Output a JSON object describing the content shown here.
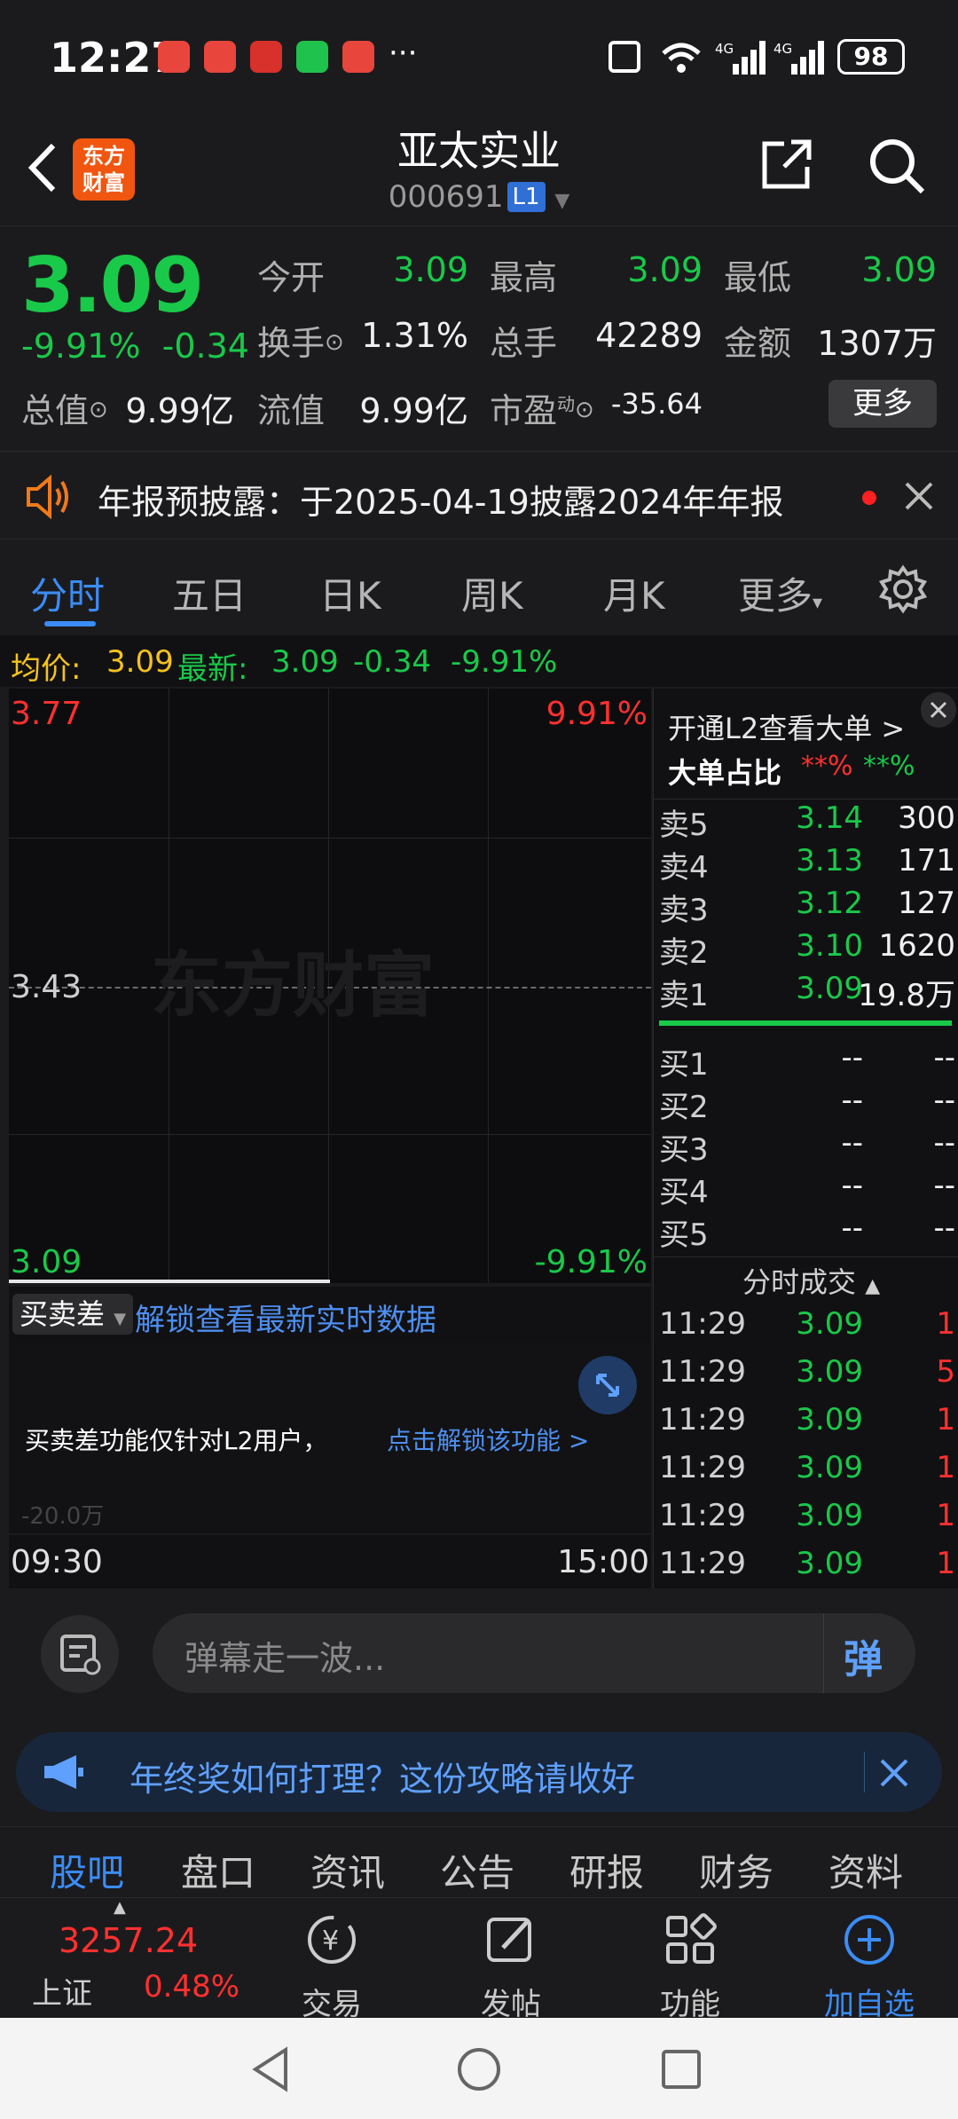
{
  "status_bar": {
    "time": "12:27",
    "battery": "98",
    "network": "4G"
  },
  "header": {
    "logo_line1": "东方",
    "logo_line2": "财富",
    "title": "亚太实业",
    "code": "000691",
    "level": "L1"
  },
  "quote": {
    "price": "3.09",
    "change_pct": "-9.91%",
    "change": "-0.34",
    "open_label": "今开",
    "open": "3.09",
    "high_label": "最高",
    "high": "3.09",
    "low_label": "最低",
    "low": "3.09",
    "turnover_label": "换手",
    "turnover": "1.31%",
    "volume_label": "总手",
    "volume": "42289",
    "amount_label": "金额",
    "amount": "1307万",
    "mcap_label": "总值",
    "mcap": "9.99亿",
    "float_label": "流值",
    "float": "9.99亿",
    "pe_label": "市盈",
    "pe_sup": "动",
    "pe": "-35.64",
    "more_label": "更多"
  },
  "notice": {
    "text": "年报预披露：于2025-04-19披露2024年年报"
  },
  "tabs": [
    "分时",
    "五日",
    "日K",
    "周K",
    "月K",
    "更多"
  ],
  "avg_line": {
    "avg_label": "均价:",
    "avg": "3.09",
    "latest_label": "最新:",
    "latest": "3.09",
    "change": "-0.34",
    "pct": "-9.91%"
  },
  "chart": {
    "top_price": "3.77",
    "top_pct": "9.91%",
    "mid_price": "3.43",
    "bottom_price": "3.09",
    "bottom_pct": "-9.91%",
    "watermark": "东方财富",
    "start_time": "09:30",
    "end_time": "15:00"
  },
  "sub_chart": {
    "selector": "买卖差",
    "unlock_link": "解锁查看最新实时数据",
    "info_text": "买卖差功能仅针对L2用户，",
    "info_link": "点击解锁该功能 >",
    "axis_label": "-20.0万"
  },
  "order_book": {
    "l2_link": "开通L2查看大单 >",
    "big_label": "大单占比",
    "big_red": "**%",
    "big_green": "**%",
    "sells": [
      {
        "label": "卖5",
        "price": "3.14",
        "vol": "300"
      },
      {
        "label": "卖4",
        "price": "3.13",
        "vol": "171"
      },
      {
        "label": "卖3",
        "price": "3.12",
        "vol": "127"
      },
      {
        "label": "卖2",
        "price": "3.10",
        "vol": "1620"
      },
      {
        "label": "卖1",
        "price": "3.09",
        "vol": "19.8万"
      }
    ],
    "buys": [
      {
        "label": "买1",
        "price": "--",
        "vol": "--"
      },
      {
        "label": "买2",
        "price": "--",
        "vol": "--"
      },
      {
        "label": "买3",
        "price": "--",
        "vol": "--"
      },
      {
        "label": "买4",
        "price": "--",
        "vol": "--"
      },
      {
        "label": "买5",
        "price": "--",
        "vol": "--"
      }
    ],
    "trades_label": "分时成交",
    "trades": [
      {
        "time": "11:29",
        "price": "3.09",
        "vol": "1"
      },
      {
        "time": "11:29",
        "price": "3.09",
        "vol": "5"
      },
      {
        "time": "11:29",
        "price": "3.09",
        "vol": "1"
      },
      {
        "time": "11:29",
        "price": "3.09",
        "vol": "1"
      },
      {
        "time": "11:29",
        "price": "3.09",
        "vol": "1"
      },
      {
        "time": "11:29",
        "price": "3.09",
        "vol": "1"
      }
    ]
  },
  "comment": {
    "placeholder": "弹幕走一波...",
    "danmu_label": "弹"
  },
  "promo": {
    "text": "年终奖如何打理？这份攻略请收好"
  },
  "sub_tabs": [
    "股吧",
    "盘口",
    "资讯",
    "公告",
    "研报",
    "财务",
    "资料"
  ],
  "bottom_nav": {
    "index_value": "3257.24",
    "index_name": "上证",
    "index_pct": "0.48%",
    "trade": "交易",
    "post": "发帖",
    "function": "功能",
    "add": "加自选"
  }
}
